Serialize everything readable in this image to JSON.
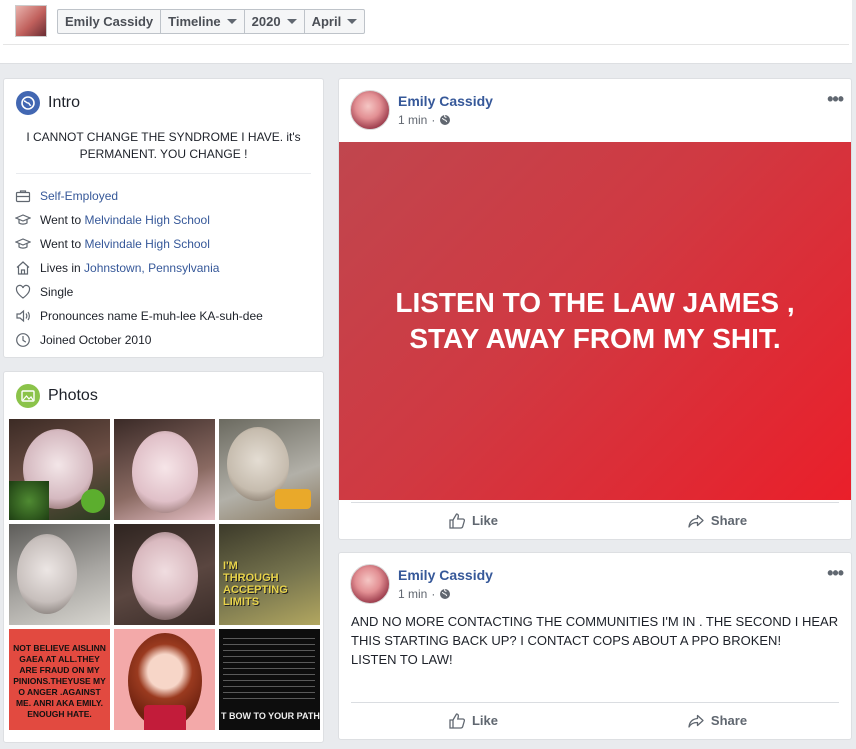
{
  "header": {
    "crumbs": [
      "Emily Cassidy",
      "Timeline",
      "2020",
      "April"
    ]
  },
  "intro": {
    "title": "Intro",
    "bio": "I CANNOT CHANGE THE SYNDROME I HAVE. it's PERMANENT. YOU CHANGE !",
    "work": "Self-Employed",
    "edu1_prefix": "Went to ",
    "edu1_link": "Melvindale High School",
    "edu2_prefix": "Went to ",
    "edu2_link": "Melvindale High School",
    "lives_prefix": "Lives in ",
    "lives_link": "Johnstown, Pennsylvania",
    "relationship": "Single",
    "pronounce": "Pronounces name E-muh-lee KA-suh-dee",
    "joined": "Joined October 2010"
  },
  "photos": {
    "title": "Photos",
    "tile6_text": "I'M THROUGH ACCEPTING LIMITS",
    "tile7_text": "NOT BELIEVE AISLINN GAEA AT ALL.THEY ARE FRAUD ON MY PINIONS.THEYUSE MY O ANGER .Against me. ANRI AKA EMILY. ENOUGH HATE.",
    "tile9_text": "T BOW TO YOUR PATHET"
  },
  "posts": [
    {
      "author": "Emily Cassidy",
      "time": "1 min",
      "banner_text": "LISTEN TO THE LAW JAMES , STAY AWAY FROM MY SHIT.",
      "like_label": "Like",
      "share_label": "Share"
    },
    {
      "author": "Emily Cassidy",
      "time": "1 min",
      "body_line1": "AND NO MORE CONTACTING THE COMMUNITIES I'M IN . THE SECOND I HEAR THIS STARTING BACK UP? I CONTACT COPS ABOUT A PPO BROKEN!",
      "body_line2": "LISTEN TO LAW!",
      "like_label": "Like",
      "share_label": "Share"
    }
  ],
  "colors": {
    "link": "#365899",
    "banner_red": "#d03942",
    "intro_icon": "#4267b2",
    "photos_icon": "#8bc34a"
  }
}
